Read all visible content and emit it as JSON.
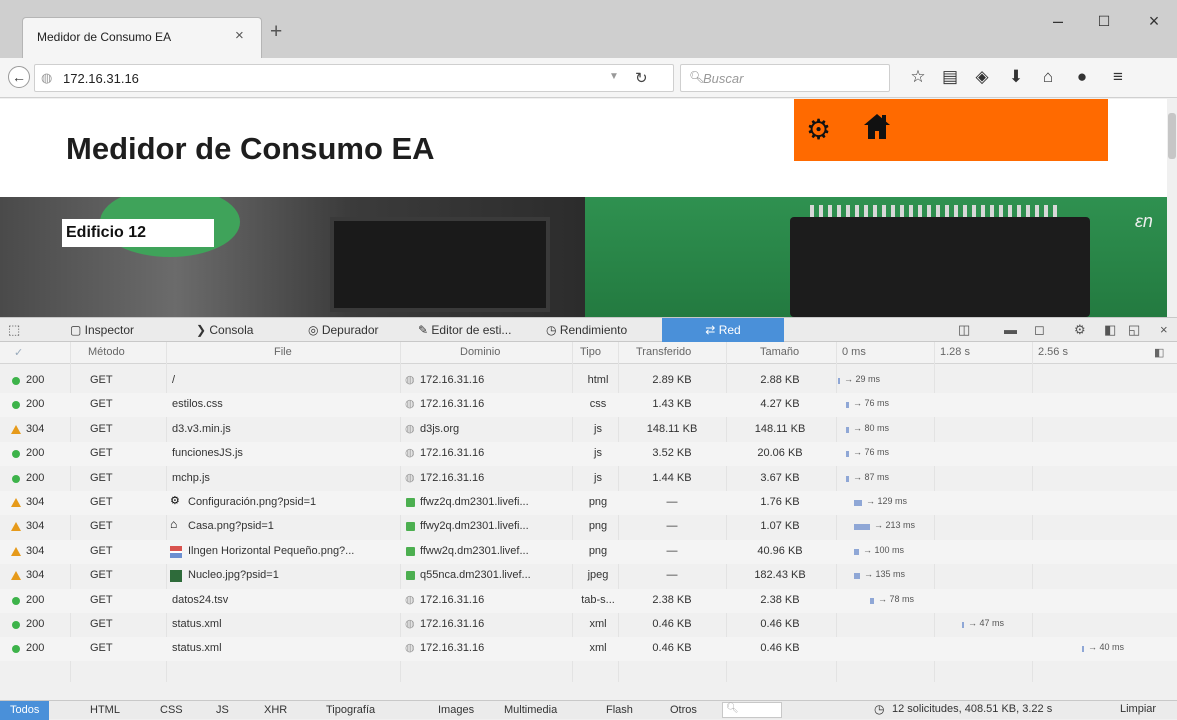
{
  "browser": {
    "tab_title": "Medidor de Consumo EA",
    "tab_close": "×",
    "new_tab": "+",
    "window_controls": [
      "–",
      "☐",
      "×"
    ],
    "url": "172.16.31.16",
    "search_placeholder": "Buscar"
  },
  "page": {
    "title": "Medidor de Consumo EA",
    "banner_label": "Edificio 12",
    "accent_color": "#ff6a00",
    "icons": [
      "gear-icon",
      "home-icon"
    ]
  },
  "devtools": {
    "tabs": [
      "Inspector",
      "Consola",
      "Depurador",
      "Editor de esti...",
      "Rendimiento",
      "Red"
    ],
    "active_tab": "Red",
    "columns": [
      "Método",
      "File",
      "Dominio",
      "Tipo",
      "Transferido",
      "Tamaño",
      "0 ms",
      "1.28 s",
      "2.56 s"
    ],
    "rows": [
      {
        "status": "200",
        "method": "GET",
        "file": "/",
        "domain": "172.16.31.16",
        "type": "html",
        "transferred": "2.89 KB",
        "size": "2.88 KB",
        "time": "→ 29 ms",
        "kind": "ok",
        "secure": false
      },
      {
        "status": "200",
        "method": "GET",
        "file": "estilos.css",
        "domain": "172.16.31.16",
        "type": "css",
        "transferred": "1.43 KB",
        "size": "4.27 KB",
        "time": "→ 76 ms",
        "kind": "ok",
        "secure": false
      },
      {
        "status": "304",
        "method": "GET",
        "file": "d3.v3.min.js",
        "domain": "d3js.org",
        "type": "js",
        "transferred": "148.11 KB",
        "size": "148.11 KB",
        "time": "→ 80 ms",
        "kind": "cached",
        "secure": false
      },
      {
        "status": "200",
        "method": "GET",
        "file": "funcionesJS.js",
        "domain": "172.16.31.16",
        "type": "js",
        "transferred": "3.52 KB",
        "size": "20.06 KB",
        "time": "→ 76 ms",
        "kind": "ok",
        "secure": false
      },
      {
        "status": "200",
        "method": "GET",
        "file": "mchp.js",
        "domain": "172.16.31.16",
        "type": "js",
        "transferred": "1.44 KB",
        "size": "3.67 KB",
        "time": "→ 87 ms",
        "kind": "ok",
        "secure": false
      },
      {
        "status": "304",
        "method": "GET",
        "file": "Configuración.png?psid=1",
        "domain": "ffwz2q.dm2301.livefi...",
        "type": "png",
        "transferred": "—",
        "size": "1.76 KB",
        "time": "→ 129 ms",
        "kind": "cached",
        "secure": true
      },
      {
        "status": "304",
        "method": "GET",
        "file": "Casa.png?psid=1",
        "domain": "ffwy2q.dm2301.livefi...",
        "type": "png",
        "transferred": "—",
        "size": "1.07 KB",
        "time": "→ 213 ms",
        "kind": "cached",
        "secure": true
      },
      {
        "status": "304",
        "method": "GET",
        "file": "Ilngen Horizontal Pequeño.png?...",
        "domain": "ffww2q.dm2301.livef...",
        "type": "png",
        "transferred": "—",
        "size": "40.96 KB",
        "time": "→ 100 ms",
        "kind": "cached",
        "secure": true
      },
      {
        "status": "304",
        "method": "GET",
        "file": "Nucleo.jpg?psid=1",
        "domain": "q55nca.dm2301.livef...",
        "type": "jpeg",
        "transferred": "—",
        "size": "182.43 KB",
        "time": "→ 135 ms",
        "kind": "cached",
        "secure": true
      },
      {
        "status": "200",
        "method": "GET",
        "file": "datos24.tsv",
        "domain": "172.16.31.16",
        "type": "tab-s...",
        "transferred": "2.38 KB",
        "size": "2.38 KB",
        "time": "→ 78 ms",
        "kind": "ok",
        "secure": false
      },
      {
        "status": "200",
        "method": "GET",
        "file": "status.xml",
        "domain": "172.16.31.16",
        "type": "xml",
        "transferred": "0.46 KB",
        "size": "0.46 KB",
        "time": "→ 47 ms",
        "kind": "ok",
        "secure": false
      },
      {
        "status": "200",
        "method": "GET",
        "file": "status.xml",
        "domain": "172.16.31.16",
        "type": "xml",
        "transferred": "0.46 KB",
        "size": "0.46 KB",
        "time": "→ 40 ms",
        "kind": "ok",
        "secure": false
      }
    ],
    "filters": [
      "Todos",
      "HTML",
      "CSS",
      "JS",
      "XHR",
      "Tipografía",
      "Images",
      "Multimedia",
      "Flash",
      "Otros"
    ],
    "active_filter": "Todos",
    "summary": "12 solicitudes, 408.51 KB, 3.22 s",
    "clear_label": "Limpiar"
  }
}
